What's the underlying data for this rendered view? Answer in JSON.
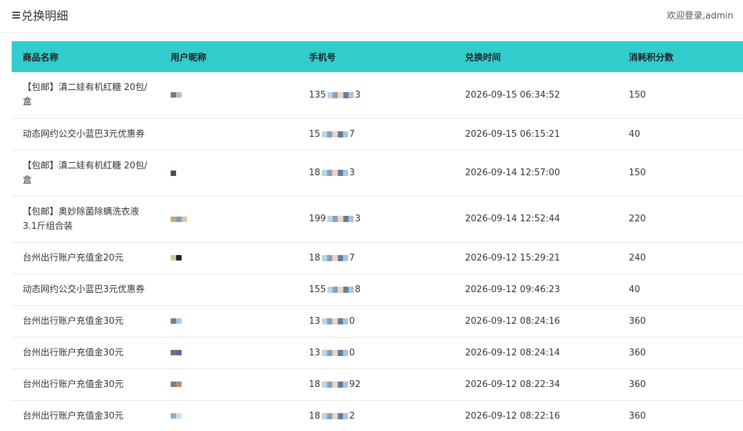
{
  "header": {
    "title": "兑换明细",
    "welcome": "欢迎登录,admin"
  },
  "table": {
    "columns": [
      "商品名称",
      "用户昵称",
      "手机号",
      "兑换时间",
      "消耗积分数"
    ],
    "rows": [
      {
        "product": "【包邮】滇二娃有机红糖 20包/盒",
        "nickname_colors": [
          "#7a7a7a",
          "#bdbdbd"
        ],
        "phone_start": "135",
        "phone_end": "3",
        "time": "2026-09-15 06:34:52",
        "points": "150"
      },
      {
        "product": "动态网约公交小蓝巴3元优惠券",
        "nickname_colors": [],
        "phone_start": "15",
        "phone_end": "7",
        "time": "2026-09-15 06:15:21",
        "points": "40"
      },
      {
        "product": "【包邮】滇二娃有机红糖 20包/盒",
        "nickname_colors": [
          "#5a4660"
        ],
        "phone_start": "18",
        "phone_end": "3",
        "time": "2026-09-14 12:57:00",
        "points": "150"
      },
      {
        "product": "【包邮】奥妙除菌除螨洗衣液3.1斤组合装",
        "nickname_colors": [
          "#c8a888",
          "#8a9ab8",
          "#e0c8a0"
        ],
        "phone_start": "199",
        "phone_end": "3",
        "time": "2026-09-14 12:52:44",
        "points": "220"
      },
      {
        "product": "台州出行账户充值金20元",
        "nickname_colors": [
          "#d8c0a8",
          "#222222"
        ],
        "phone_start": "18",
        "phone_end": "7",
        "time": "2026-09-12 15:29:21",
        "points": "240"
      },
      {
        "product": "动态网约公交小蓝巴3元优惠券",
        "nickname_colors": [],
        "phone_start": "155",
        "phone_end": "8",
        "time": "2026-09-12 09:46:23",
        "points": "40"
      },
      {
        "product": "台州出行账户充值金30元",
        "nickname_colors": [
          "#8a7a7a",
          "#a8c8e0"
        ],
        "phone_start": "13",
        "phone_end": "0",
        "time": "2026-09-12 08:24:16",
        "points": "360"
      },
      {
        "product": "台州出行账户充值金30元",
        "nickname_colors": [
          "#7a6a8a",
          "#5a6a9a"
        ],
        "phone_start": "13",
        "phone_end": "0",
        "time": "2026-09-12 08:24:14",
        "points": "360"
      },
      {
        "product": "台州出行账户充值金30元",
        "nickname_colors": [
          "#8a7a6a",
          "#b09070"
        ],
        "phone_start": "18",
        "phone_end": "92",
        "time": "2026-09-12 08:22:34",
        "points": "360"
      },
      {
        "product": "台州出行账户充值金30元",
        "nickname_colors": [
          "#8ab0d0",
          "#c8e0f0"
        ],
        "phone_start": "18",
        "phone_end": "2",
        "time": "2026-09-12 08:22:16",
        "points": "360"
      }
    ]
  },
  "colors": {
    "header_bg": "#33cccc"
  }
}
